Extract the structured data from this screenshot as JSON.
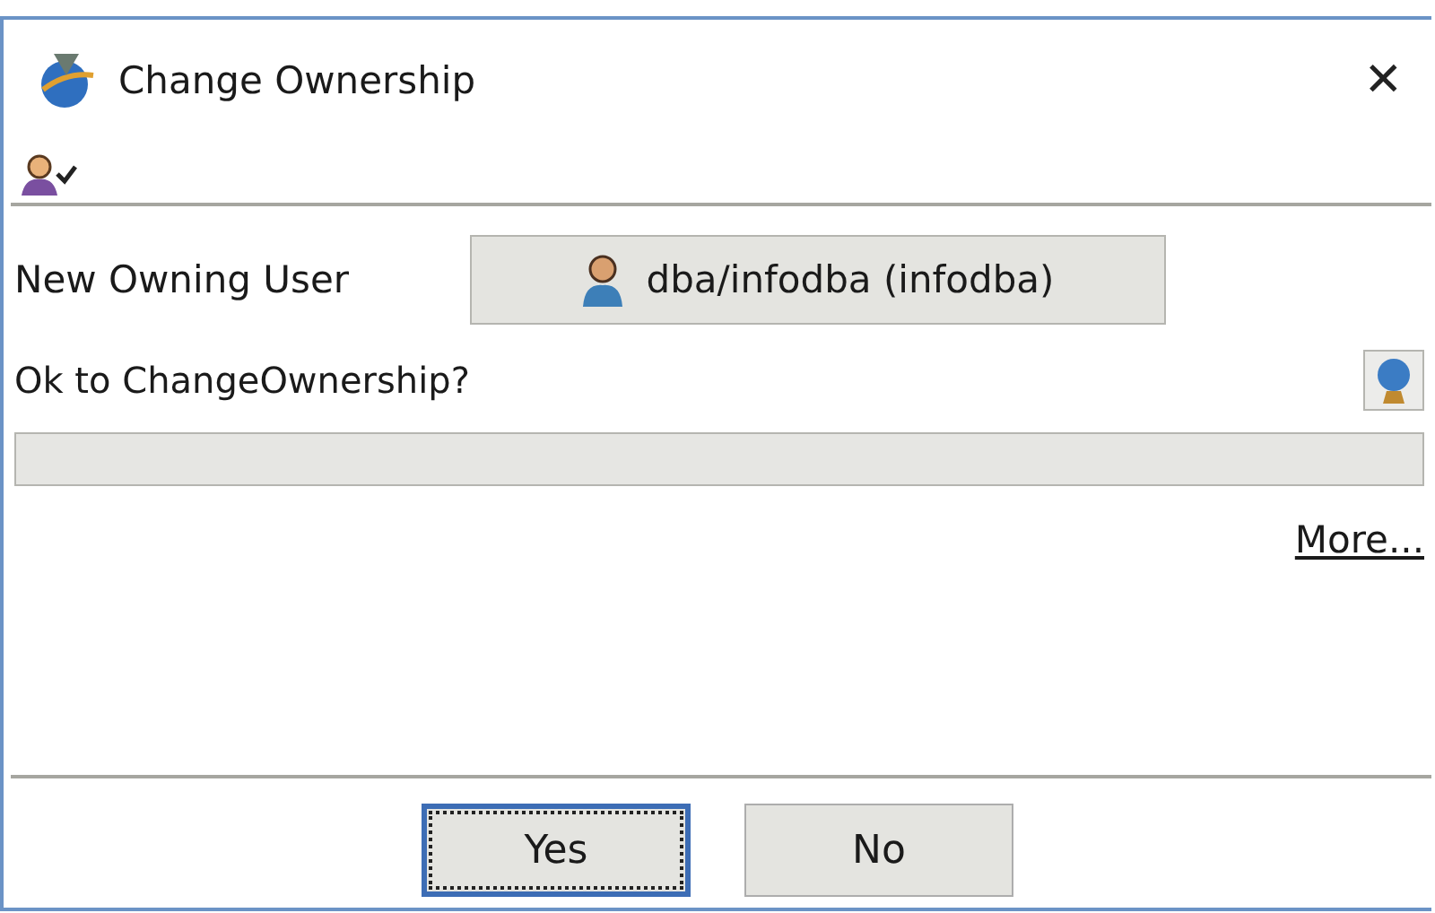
{
  "window": {
    "title": "Change Ownership",
    "close": "✕"
  },
  "form": {
    "owner_label": "New Owning User",
    "owner_value": "dba/infodba (infodba)",
    "question": "Ok to ChangeOwnership?",
    "progress": {
      "level": 0
    },
    "more_link": "More..."
  },
  "buttons": [
    {
      "label": "Yes",
      "focused": true
    },
    {
      "label": "No",
      "focused": false
    }
  ]
}
